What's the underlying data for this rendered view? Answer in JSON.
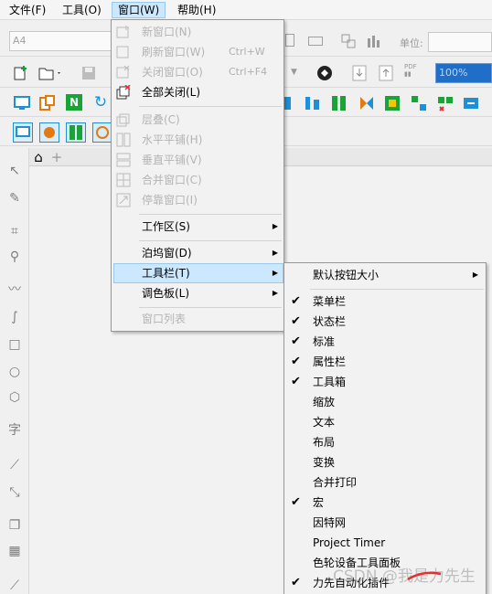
{
  "menubar": {
    "items": [
      {
        "label": "文件(F)",
        "underline": "F"
      },
      {
        "label": "工具(O)"
      },
      {
        "label": "窗口(W)"
      },
      {
        "label": "帮助(H)"
      }
    ]
  },
  "property_bar": {
    "paper_size": "A4",
    "unit_label": "单位:",
    "zoom": "100%"
  },
  "window_menu": {
    "items": [
      {
        "label": "新窗口(N)",
        "enabled": false
      },
      {
        "label": "刷新窗口(W)",
        "shortcut": "Ctrl+W",
        "enabled": false
      },
      {
        "label": "关闭窗口(O)",
        "shortcut": "Ctrl+F4",
        "enabled": false
      },
      {
        "label": "全部关闭(L)",
        "enabled": true
      },
      {
        "label": "层叠(C)",
        "enabled": false
      },
      {
        "label": "水平平铺(H)",
        "enabled": false
      },
      {
        "label": "垂直平铺(V)",
        "enabled": false
      },
      {
        "label": "合并窗口(C)",
        "enabled": false
      },
      {
        "label": "停靠窗口(I)",
        "enabled": false
      },
      {
        "label": "工作区(S)",
        "enabled": true,
        "submenu": true
      },
      {
        "label": "泊坞窗(D)",
        "enabled": true,
        "submenu": true
      },
      {
        "label": "工具栏(T)",
        "enabled": true,
        "submenu": true,
        "highlighted": true
      },
      {
        "label": "调色板(L)",
        "enabled": true,
        "submenu": true
      },
      {
        "label": "窗口列表",
        "enabled": false
      }
    ]
  },
  "toolbar_submenu": {
    "items": [
      {
        "label": "默认按钮大小",
        "checked": false,
        "submenu": true
      },
      {
        "label": "菜单栏",
        "checked": true
      },
      {
        "label": "状态栏",
        "checked": true
      },
      {
        "label": "标准",
        "checked": true
      },
      {
        "label": "属性栏",
        "checked": true
      },
      {
        "label": "工具箱",
        "checked": true
      },
      {
        "label": "缩放",
        "checked": false
      },
      {
        "label": "文本",
        "checked": false
      },
      {
        "label": "布局",
        "checked": false
      },
      {
        "label": "变换",
        "checked": false
      },
      {
        "label": "合并打印",
        "checked": false
      },
      {
        "label": "宏",
        "checked": true
      },
      {
        "label": "因特网",
        "checked": false
      },
      {
        "label": "Project Timer",
        "checked": false
      },
      {
        "label": "色轮设备工具面板",
        "checked": false
      },
      {
        "label": "力先自动化插件",
        "checked": true
      }
    ]
  },
  "glyphs": {
    "check": "✔",
    "arrow": "▶",
    "home": "⌂",
    "plus": "+"
  },
  "watermark": "CSDN @我是力先生",
  "colors": {
    "accent": "#cce8ff",
    "accent_border": "#99c9ef",
    "disabled": "#b4b4b4"
  }
}
